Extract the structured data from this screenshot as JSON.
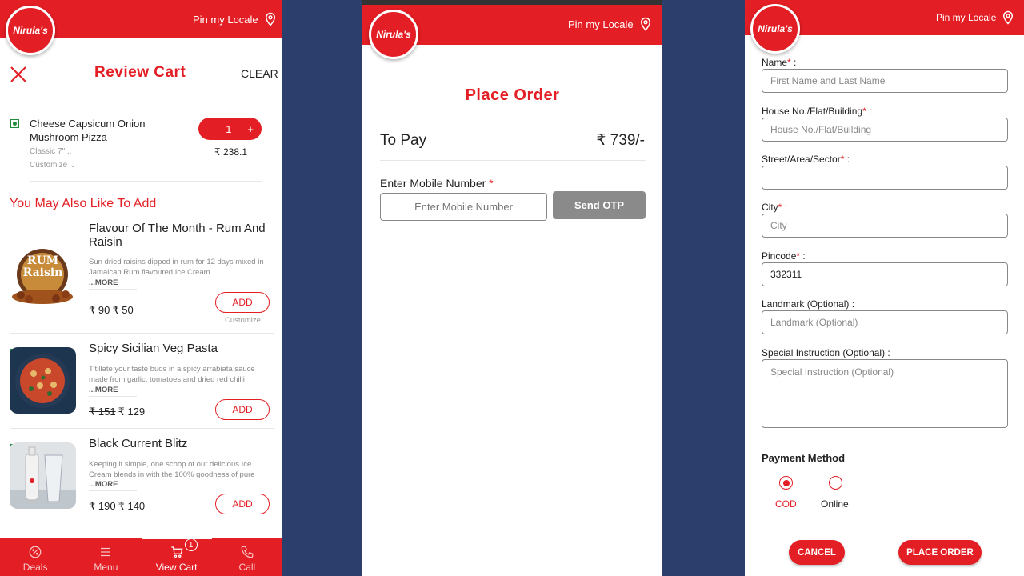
{
  "brand": {
    "logo_text": "Nirula's",
    "accent": "#e31e24",
    "background": "#2c3e6b"
  },
  "header": {
    "locale_label": "Pin my Locale",
    "locale_icon": "map-pin-icon"
  },
  "cart": {
    "title": "Review Cart",
    "clear_label": "CLEAR",
    "item": {
      "name": "Cheese Capsicum Onion Mushroom Pizza",
      "variant": "Classic 7\"...",
      "customize": "Customize",
      "qty": "1",
      "minus": "-",
      "plus": "+",
      "price": "₹ 238.1"
    },
    "suggest_title": "You May Also Like To Add",
    "products": [
      {
        "name": "Flavour Of The Month - Rum And Raisin",
        "desc": "Sun dried raisins dipped in rum for 12 days mixed in Jamaican Rum flavoured Ice Cream.",
        "more": "...MORE",
        "old_price": "₹ 90",
        "price": "₹ 50",
        "add": "ADD",
        "customize": "Customize",
        "image_text": "RUM Raisin"
      },
      {
        "name": "Spicy Sicilian Veg Pasta",
        "desc": "Titillate your taste buds in a spicy arrabiata sauce made from garlic, tomatoes and dried red chilli",
        "more": "...MORE",
        "old_price": "₹ 151",
        "price": "₹ 129",
        "add": "ADD"
      },
      {
        "name": "Black Current Blitz",
        "desc": "Keeping it simple, one scoop of our delicious Ice Cream blends in with the 100% goodness of pure",
        "more": "...MORE",
        "old_price": "₹ 190",
        "price": "₹ 140",
        "add": "ADD"
      }
    ]
  },
  "nav": {
    "deals": "Deals",
    "menu": "Menu",
    "view_cart": "View Cart",
    "call": "Call",
    "cart_count": "1"
  },
  "order": {
    "title": "Place Order",
    "to_pay_label": "To Pay",
    "to_pay_value": "₹ 739/-",
    "mobile_label": "Enter Mobile Number",
    "required_mark": "*",
    "mobile_placeholder": "Enter Mobile Number",
    "otp_button": "Send OTP"
  },
  "address": {
    "name_label": "Name",
    "name_placeholder": "First Name and Last Name",
    "house_label": "House No./Flat/Building",
    "house_placeholder": "House No./Flat/Building",
    "street_label": "Street/Area/Sector",
    "street_value": "",
    "city_label": "City",
    "city_placeholder": "City",
    "pincode_label": "Pincode",
    "pincode_value": "332311",
    "landmark_label": "Landmark (Optional) :",
    "landmark_placeholder": "Landmark (Optional)",
    "instruction_label": "Special Instruction (Optional) :",
    "instruction_placeholder": "Special Instruction (Optional)",
    "colon": " :",
    "payment_title": "Payment Method",
    "payment_options": [
      "COD",
      "Online"
    ],
    "payment_selected": "COD",
    "cancel_button": "CANCEL",
    "place_button": "PLACE ORDER"
  }
}
